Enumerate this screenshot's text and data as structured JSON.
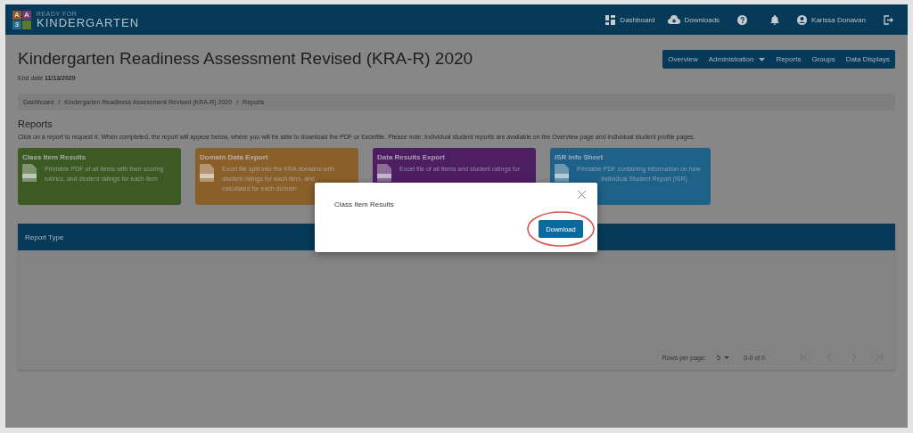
{
  "header": {
    "logo_tiles": [
      {
        "text": "A",
        "color": "#8a5a2a"
      },
      {
        "text": "A",
        "color": "#7a3a6a"
      },
      {
        "text": "3",
        "color": "#2a6a8a"
      },
      {
        "color": "#5a7a2a"
      }
    ],
    "logo_small": "READY FOR",
    "logo_big": "KINDERGARTEN",
    "links": [
      {
        "kind": "dashboard",
        "label": "Dashboard"
      },
      {
        "kind": "downloads",
        "label": "Downloads"
      },
      {
        "kind": "help"
      },
      {
        "kind": "bell"
      },
      {
        "kind": "user",
        "label": "Karissa Donavan"
      },
      {
        "kind": "logout"
      }
    ]
  },
  "page": {
    "title": "Kindergarten Readiness Assessment Revised (KRA-R) 2020",
    "end_date_label": "End date",
    "end_date": "11/13/2020"
  },
  "nav": [
    {
      "label": "Overview",
      "dropdown": false
    },
    {
      "label": "Administration",
      "dropdown": true
    },
    {
      "label": "Reports",
      "dropdown": false
    },
    {
      "label": "Groups",
      "dropdown": false
    },
    {
      "label": "Data Displays",
      "dropdown": false
    }
  ],
  "breadcrumb": {
    "separator": "/",
    "items": [
      "Dashboard",
      "Kindergarten Readiness Assessment Revised (KRA-R) 2020",
      "Reports"
    ]
  },
  "reports": {
    "heading": "Reports",
    "intro": "Click on a report to request it. When completed, the report will appear below, where you will be able to download the PDF or Excelfile. Please note: Individual student reports are available on the Overview page and individual student profile pages.",
    "cards": [
      {
        "title": "Class Item Results",
        "color": "#3d5a22",
        "lines": [
          "Printable PDF of all items with their scoring",
          "rubrics, and student ratings for each item"
        ]
      },
      {
        "title": "Domain Data Export",
        "color": "#8a5f2a",
        "lines": [
          "Excel file split into the KRA domains with",
          "student ratings for each item, and",
          "calculated for each domain"
        ]
      },
      {
        "title": "Data Results Export",
        "color": "#4e1e62",
        "lines": [
          "Excel file of all items and student ratings for"
        ]
      },
      {
        "title": "ISR Info Sheet",
        "color": "#1e6189",
        "lines": [
          "Printable PDF containing information on how",
          "Individual Student Report (ISR)"
        ]
      }
    ]
  },
  "table": {
    "header": "Report Type",
    "rows_per_page_label": "Rows per page:",
    "rows_per_page": "5",
    "range": "0-0 of 0"
  },
  "modal": {
    "title": "Class Item Results",
    "button": "Download"
  }
}
